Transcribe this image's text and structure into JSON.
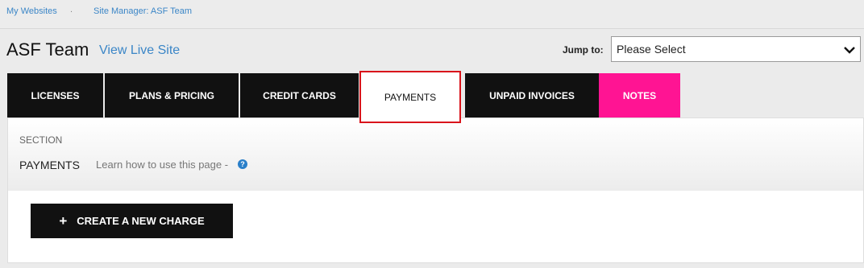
{
  "breadcrumb": {
    "items": [
      "My Websites",
      "Site Manager: ASF Team"
    ],
    "separator": "."
  },
  "header": {
    "title": "ASF Team",
    "live_link": "View Live Site",
    "jump_label": "Jump to:",
    "jump_value": "Please Select"
  },
  "tabs": [
    {
      "label": "LICENSES"
    },
    {
      "label": "PLANS & PRICING"
    },
    {
      "label": "CREDIT CARDS"
    },
    {
      "label": "PAYMENTS",
      "active": true
    },
    {
      "label": "UNPAID INVOICES"
    },
    {
      "label": "NOTES",
      "color": "#ff1493"
    }
  ],
  "section": {
    "label": "SECTION",
    "name": "PAYMENTS",
    "help_text": "Learn how to use this page -",
    "help_icon": "?"
  },
  "actions": {
    "create_label": "CREATE A NEW CHARGE",
    "create_icon": "plus-icon"
  },
  "colors": {
    "accent": "#3b86c7",
    "pink": "#ff1493",
    "highlight_border": "#d9141b"
  }
}
